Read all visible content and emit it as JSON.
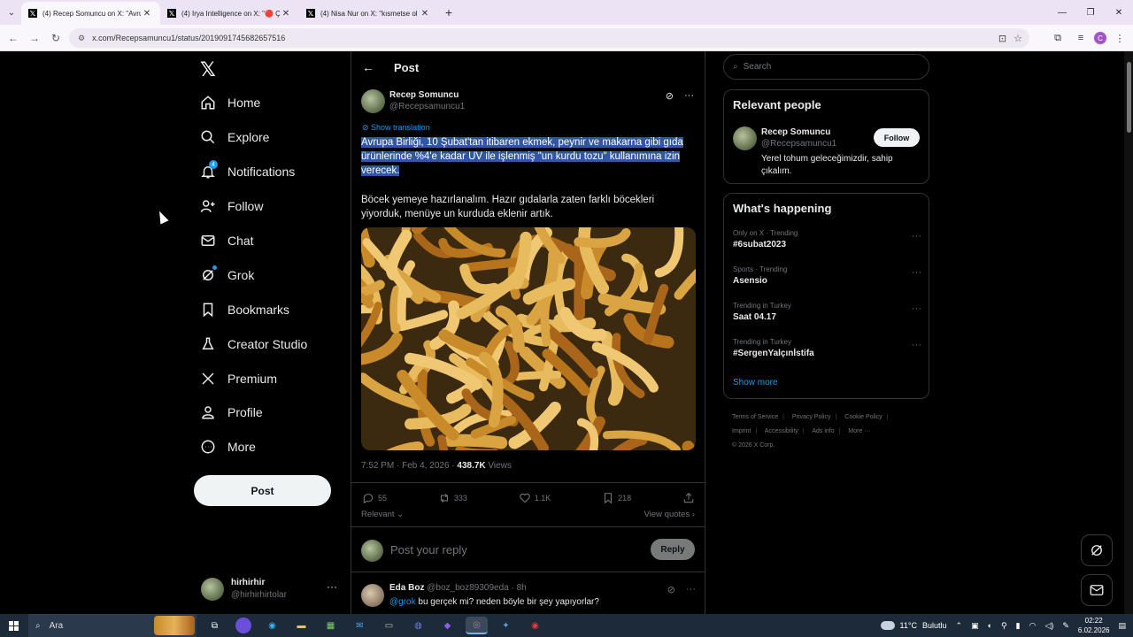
{
  "browser": {
    "tabs": [
      {
        "title": "(4) Recep Somuncu on X: \"Avrupa",
        "active": true
      },
      {
        "title": "(4) Irya Intelligence on X: \"🔴 Ç",
        "active": false
      },
      {
        "title": "(4) Nisa Nur on X: \"kısmetse ol",
        "active": false
      }
    ],
    "url": "x.com/Recepsamuncu1/status/2019091745682657516",
    "profile_initial": "C"
  },
  "nav": {
    "items": [
      {
        "label": "Home",
        "icon": "home-icon"
      },
      {
        "label": "Explore",
        "icon": "search-icon"
      },
      {
        "label": "Notifications",
        "icon": "bell-icon",
        "badge": "4"
      },
      {
        "label": "Follow",
        "icon": "follow-icon"
      },
      {
        "label": "Chat",
        "icon": "mail-icon"
      },
      {
        "label": "Grok",
        "icon": "grok-icon"
      },
      {
        "label": "Bookmarks",
        "icon": "bookmark-icon"
      },
      {
        "label": "Creator Studio",
        "icon": "creator-studio-icon"
      },
      {
        "label": "Premium",
        "icon": "x-icon"
      },
      {
        "label": "Profile",
        "icon": "person-icon"
      },
      {
        "label": "More",
        "icon": "more-circle-icon"
      }
    ],
    "post_label": "Post",
    "account": {
      "name": "hirhirhir",
      "handle": "@hirhirhirtolar"
    }
  },
  "post": {
    "header_title": "Post",
    "author_name": "Recep Somuncu",
    "author_handle": "@Recepsamuncu1",
    "show_translation": "Show translation",
    "text_selected": "Avrupa Birliği, 10 Şubat'tan itibaren ekmek, peynir ve makarna gibi gıda ürünlerinde %4'e kadar UV ile işlenmiş \"un kurdu tozu\" kullanımına izin verecek.",
    "text_second": "Böcek yemeye hazırlanalım. Hazır gıdalarla zaten farklı böcekleri yiyorduk, menüye un kurduda eklenir artık.",
    "time": "7:52 PM · Feb 4, 2026 · ",
    "views_count": "438.7K",
    "views_label": " Views",
    "replies": "55",
    "reposts": "333",
    "likes": "1.1K",
    "bookmarks": "218",
    "relevant_label": "Relevant ⌄",
    "view_quotes": "View quotes ›",
    "reply_placeholder": "Post your reply",
    "reply_button": "Reply"
  },
  "comment": {
    "name": "Eda Boz",
    "handle_time": "@boz_boz89309eda · 8h",
    "mention": "@grok",
    "text": " bu gerçek mi? neden böyle bir şey yapıyorlar?"
  },
  "right": {
    "search_placeholder": "Search",
    "relevant_people_title": "Relevant people",
    "person_name": "Recep Somuncu",
    "person_handle": "@Recepsamuncu1",
    "follow_label": "Follow",
    "person_bio": "Yerel tohum geleceğimizdir, sahip çıkalım.",
    "happening_title": "What's happening",
    "trends": [
      {
        "meta": "Only on X · Trending",
        "name": "#6subat2023"
      },
      {
        "meta": "Sports · Trending",
        "name": "Asensio"
      },
      {
        "meta": "Trending in Turkey",
        "name": "Saat 04.17"
      },
      {
        "meta": "Trending in Turkey",
        "name": "#SergenYalçınİstifa"
      }
    ],
    "show_more": "Show more",
    "footer": {
      "terms": "Terms of Service",
      "privacy": "Privacy Policy",
      "cookie": "Cookie Policy",
      "imprint": "Imprint",
      "accessibility": "Accessibility",
      "ads": "Ads info",
      "more": "More ···",
      "copyright": "© 2026 X Corp."
    }
  },
  "taskbar": {
    "search_label": "Ara",
    "weather": "11°C",
    "weather_desc": "Bulutlu",
    "time": "02:22",
    "date": "6.02.2026"
  }
}
